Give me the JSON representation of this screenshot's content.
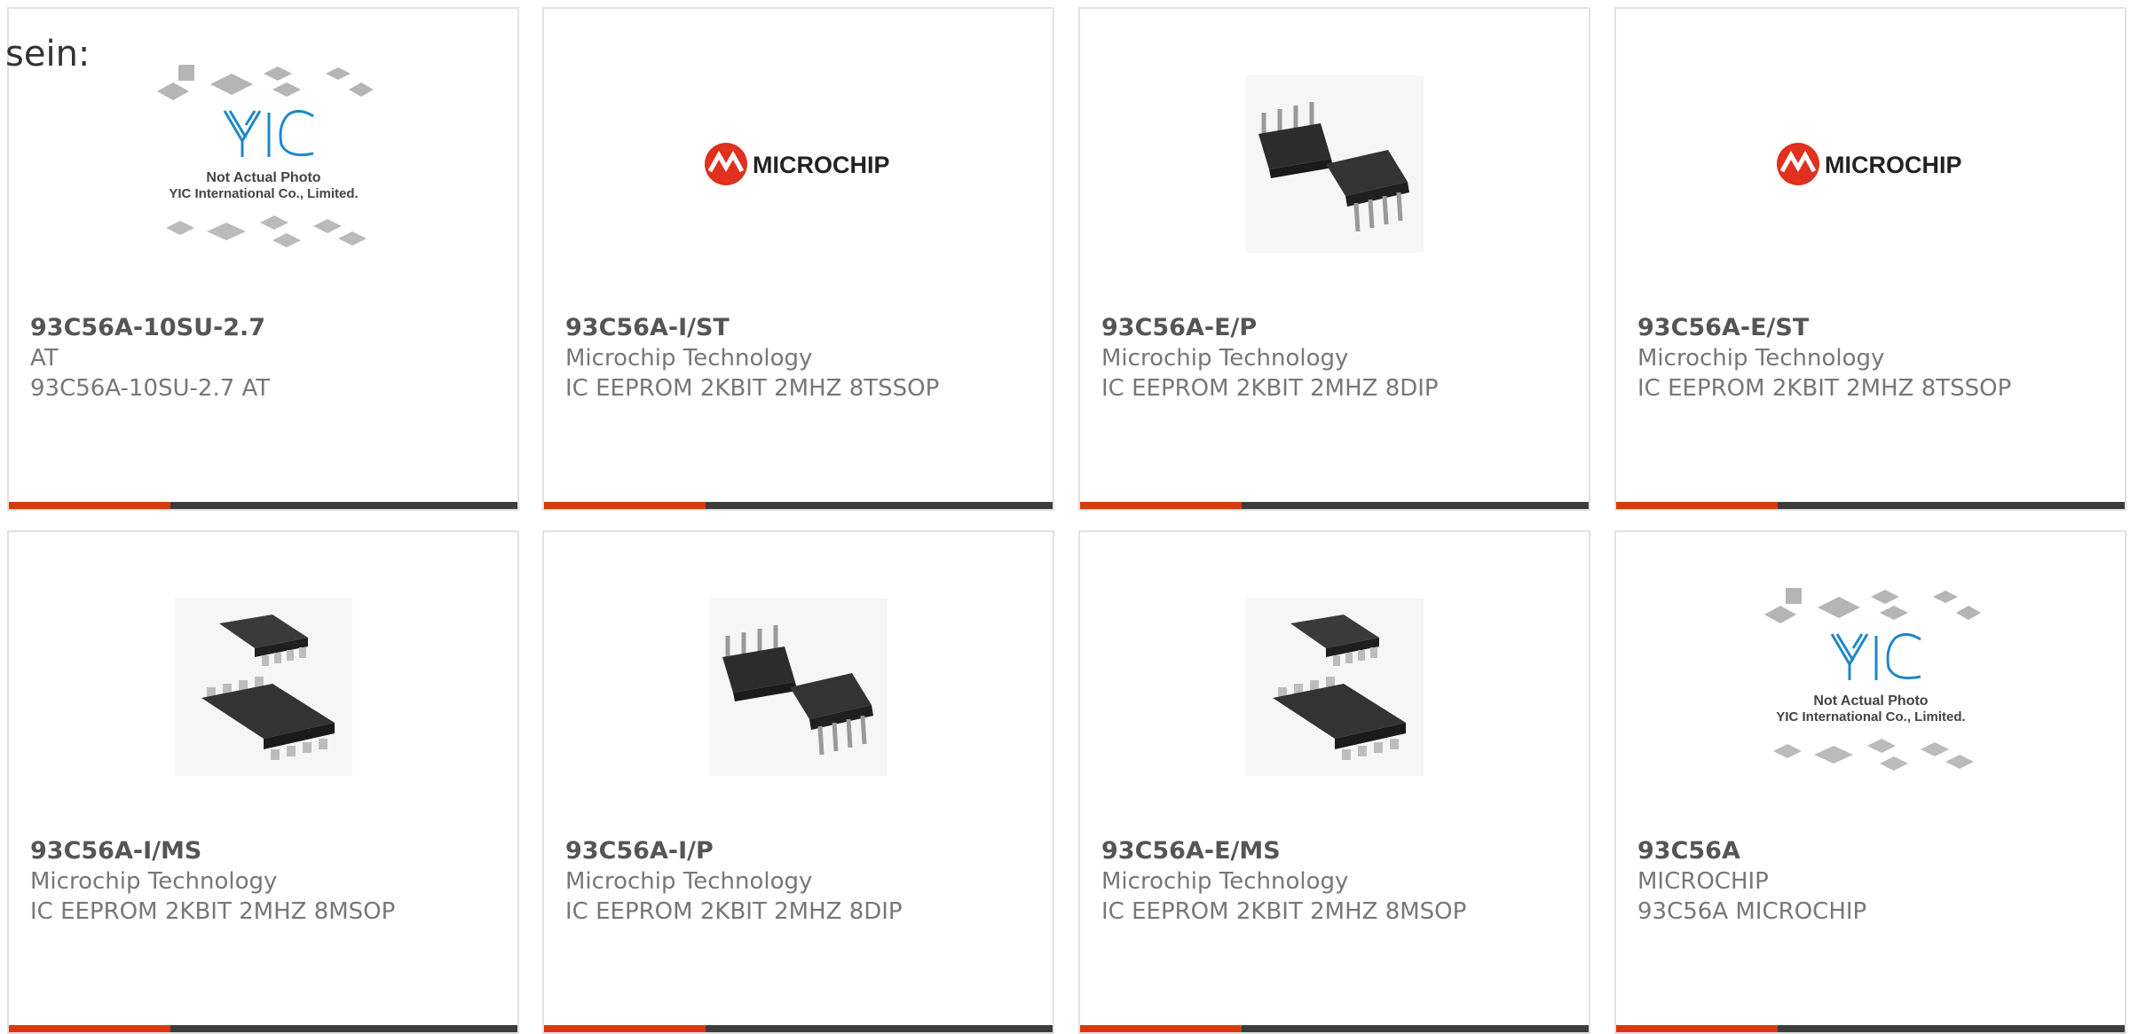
{
  "heading": "sein:",
  "products": [
    {
      "part": "93C56A-10SU-2.7",
      "manufacturer": "AT",
      "description": "93C56A-10SU-2.7 AT",
      "image": "yic-placeholder",
      "photo_note": "Not Actual Photo",
      "photo_company": "YIC International Co., Limited.",
      "logo_text": "YIC"
    },
    {
      "part": "93C56A-I/ST",
      "manufacturer": "Microchip Technology",
      "description": "IC EEPROM 2KBIT 2MHZ 8TSSOP",
      "image": "microchip-logo",
      "logo_text": "MICROCHIP"
    },
    {
      "part": "93C56A-E/P",
      "manufacturer": "Microchip Technology",
      "description": "IC EEPROM 2KBIT 2MHZ 8DIP",
      "image": "dip-chip-photo"
    },
    {
      "part": "93C56A-E/ST",
      "manufacturer": "Microchip Technology",
      "description": "IC EEPROM 2KBIT 2MHZ 8TSSOP",
      "image": "microchip-logo",
      "logo_text": "MICROCHIP"
    },
    {
      "part": "93C56A-I/MS",
      "manufacturer": "Microchip Technology",
      "description": "IC EEPROM 2KBIT 2MHZ 8MSOP",
      "image": "msop-chip-photo"
    },
    {
      "part": "93C56A-I/P",
      "manufacturer": "Microchip Technology",
      "description": "IC EEPROM 2KBIT 2MHZ 8DIP",
      "image": "dip-chip-photo"
    },
    {
      "part": "93C56A-E/MS",
      "manufacturer": "Microchip Technology",
      "description": "IC EEPROM 2KBIT 2MHZ 8MSOP",
      "image": "msop-chip-photo"
    },
    {
      "part": "93C56A",
      "manufacturer": "MICROCHIP",
      "description": "93C56A MICROCHIP",
      "image": "yic-placeholder",
      "photo_note": "Not Actual Photo",
      "photo_company": "YIC International Co., Limited.",
      "logo_text": "YIC"
    }
  ],
  "colors": {
    "accent": "#d8390f",
    "bar": "#3c3c3c",
    "border": "#e2e2e2",
    "text_bold": "#555555",
    "text": "#777777",
    "microchip_red": "#e0301e",
    "yic_blue": "#1e88c8"
  }
}
